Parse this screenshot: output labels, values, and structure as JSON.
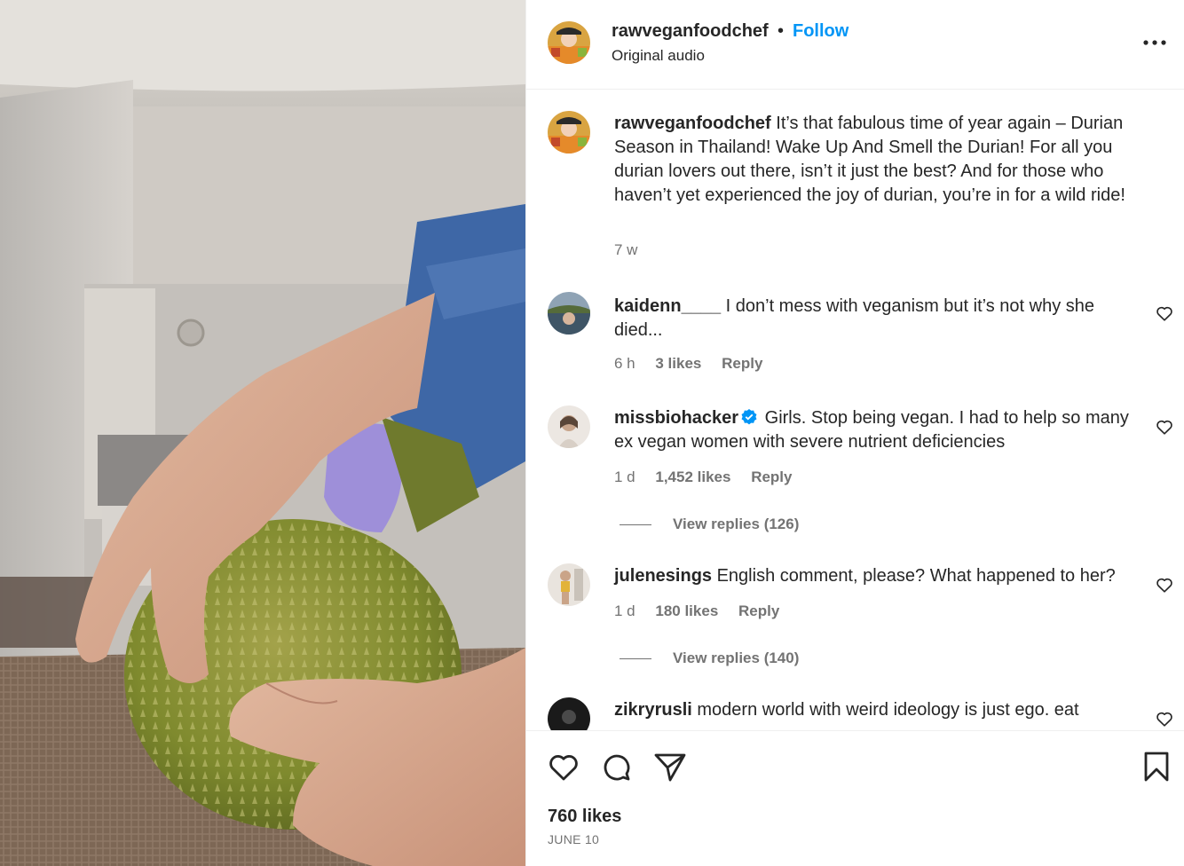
{
  "post": {
    "username": "rawveganfoodchef",
    "separator": "•",
    "follow_label": "Follow",
    "audio_label": "Original audio",
    "caption": "It’s that fabulous time of year again – Durian Season in Thailand! Wake Up And Smell the Durian! For all you durian lovers out there, isn’t it just the best? And for those who haven’t yet experienced the joy of durian, you’re in for a wild ride!",
    "caption_age": "7 w",
    "likes": "760 likes",
    "date": "JUNE 10"
  },
  "comments": [
    {
      "username": "kaidenn____",
      "text": "I don’t mess with veganism but it’s not why she died...",
      "age": "6 h",
      "likes": "3 likes",
      "reply_label": "Reply"
    },
    {
      "username": "missbiohacker",
      "verified": true,
      "text": "Girls. Stop being vegan. I had to help so many ex vegan women with severe nutrient deficiencies",
      "age": "1 d",
      "likes": "1,452 likes",
      "reply_label": "Reply",
      "view_replies": "View replies (126)"
    },
    {
      "username": "julenesings",
      "text": "English comment, please? What happened to her?",
      "age": "1 d",
      "likes": "180 likes",
      "reply_label": "Reply",
      "view_replies": "View replies (140)"
    },
    {
      "username": "zikryrusli",
      "text": "modern world with weird ideology is just ego. eat"
    }
  ],
  "icons": {
    "more": "more-options-icon",
    "like": "heart-icon",
    "comment": "comment-icon",
    "share": "share-icon",
    "save": "bookmark-icon",
    "verified": "verified-badge-icon"
  },
  "colors": {
    "link": "#0095f6",
    "text": "#262626",
    "secondary": "#737373",
    "verified": "#0095f6"
  }
}
